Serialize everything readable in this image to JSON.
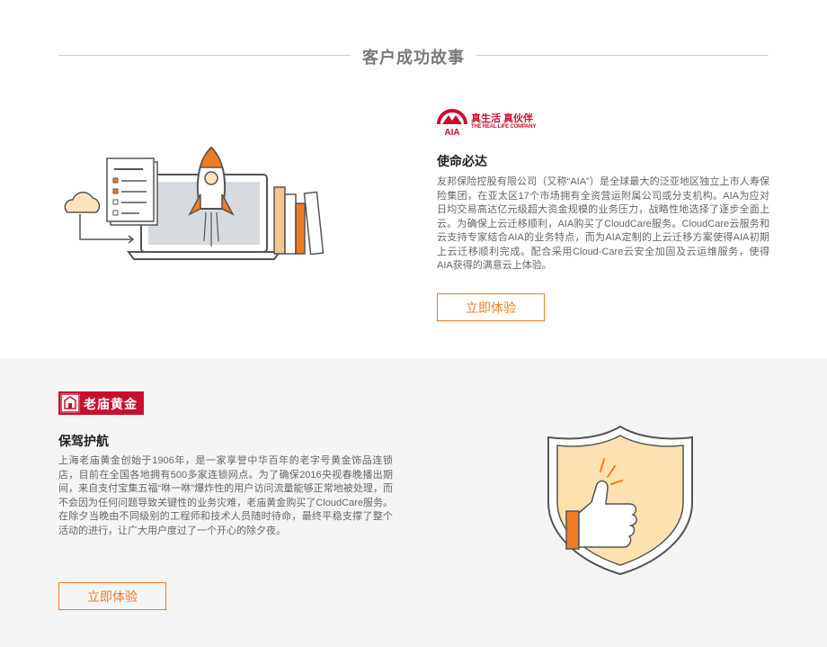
{
  "header": {
    "title": "客户成功故事"
  },
  "case1": {
    "logo": {
      "cn": "真生活 真伙伴",
      "en": "THE REAL LIFE COMPANY",
      "mark": "AIA"
    },
    "title": "使命必达",
    "description": "友邦保险控股有限公司（又称“AIA”）是全球最大的泛亚地区独立上市人寿保险集团，在亚太区17个市场拥有全资营运附属公司或分支机构。AIA为应对日均交易高达亿元级超大资金规模的业务压力，战略性地选择了逐步全面上云。为确保上云迁移顺利，AIA购买了CloudCare服务。CloudCare云服务和云支持专家结合AIA的业务特点，而为AIA定制的上云迁移方案使得AIA初期上云迁移顺利完成。配合采用Cloud-Care云安全加固及云运维服务，使得AIA获得的满意云上体验。",
    "cta": "立即体验",
    "illustration_icons": [
      "cloud-icon",
      "checklist-icon",
      "rocket-icon",
      "laptop-icon",
      "books-icon"
    ]
  },
  "case2": {
    "logo": {
      "text": "老庙黄金"
    },
    "title": "保驾护航",
    "description": "上海老庙黄金创始于1906年，是一家享誉中华百年的老字号黄金饰品连锁店，目前在全国各地拥有500多家连锁网点。为了确保2016央视春晚播出期间，来自支付宝集五福“咻一咻”爆炸性的用户访问流量能够正常地被处理，而不会因为任何问题导致关键性的业务灾难，老庙黄金购买了CloudCare服务。在除夕当晚由不同级别的工程师和技术人员随时待命，最终平稳支撑了整个活动的进行，让广大用户度过了一个开心的除夕夜。",
    "cta": "立即体验",
    "illustration_icons": [
      "shield-icon",
      "thumbs-up-icon"
    ]
  },
  "colors": {
    "accent": "#f07c21",
    "brand_red": "#c8102e",
    "section2_bg": "#f5f5f5"
  }
}
